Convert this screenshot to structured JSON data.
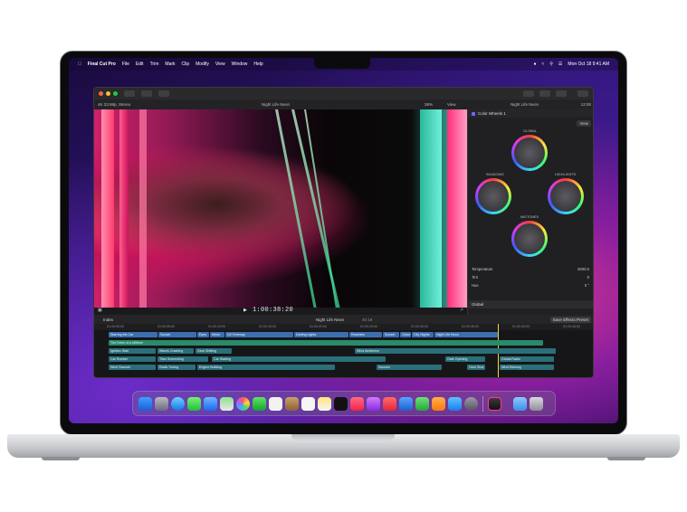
{
  "menubar": {
    "app_name": "Final Cut Pro",
    "items": [
      "File",
      "Edit",
      "Trim",
      "Mark",
      "Clip",
      "Modify",
      "View",
      "Window",
      "Help"
    ],
    "datetime": "Mon Oct 18  9:41 AM"
  },
  "window": {
    "format": "4K 23.98p, Stereo",
    "project_title": "Night Life Neon",
    "zoom": "38%",
    "view_label": "View",
    "inspector_title": "Night Life Neon",
    "inspector_duration": "12:00"
  },
  "viewer": {
    "timecode": "1:00:38:20"
  },
  "inspector": {
    "effect": "Color Wheels 1",
    "view_label": "View",
    "wheel_labels": {
      "global": "GLOBAL",
      "shadows": "SHADOWS",
      "highlights": "HIGHLIGHTS",
      "midtones": "MIDTONES"
    },
    "params": [
      {
        "label": "Temperature",
        "value": "5000.0"
      },
      {
        "label": "Tint",
        "value": "0"
      },
      {
        "label": "Hue",
        "value": "0 °"
      }
    ],
    "global_label": "Global",
    "save_label": "Save Effects Preset"
  },
  "timeline": {
    "index_label": "Index",
    "project": "Night Life Neon",
    "duration": "40:19",
    "ruler": [
      "01:00:00:00",
      "01:00:05:00",
      "01:00:10:00",
      "01:00:15:00",
      "01:00:20:00",
      "01:00:25:00",
      "01:00:30:00",
      "01:00:35:00",
      "01:00:40:00",
      "01:00:45:00"
    ],
    "row1": [
      "Starring the Car",
      "Sunset",
      "Eyes",
      "Mirror",
      "NV Freeway",
      "Darting Lights",
      "Rearview",
      "Sunset",
      "Close",
      "City Nights",
      "Night Life Neon"
    ],
    "row2": [
      "The Drive of a Lifetime"
    ],
    "row3": [
      "Ignition Start",
      "Waves Crashing",
      "Gear Shifting",
      "Wind Ambience"
    ],
    "row4": [
      "Car Rumble",
      "Tires Screeching",
      "Car Starting",
      "Gate Opening",
      "Global Radio"
    ],
    "row5": [
      "Wind Swoosh",
      "Radio Tuning",
      "Engine Building",
      "Swoosh",
      "Gear Shot",
      "Wind Blowing"
    ]
  }
}
